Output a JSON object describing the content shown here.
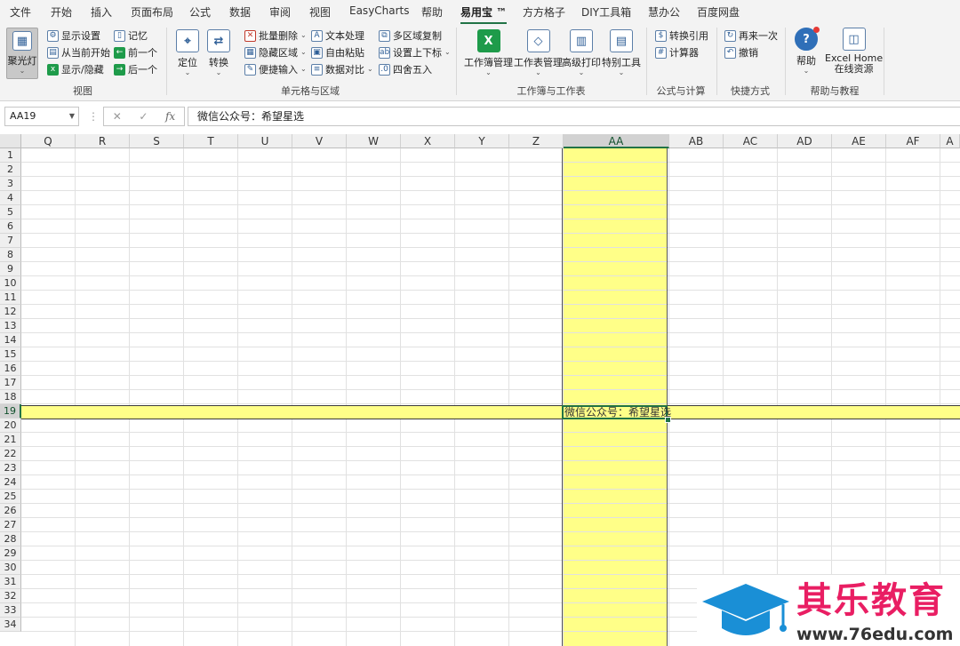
{
  "menu": {
    "tabs": [
      "文件",
      "开始",
      "插入",
      "页面布局",
      "公式",
      "数据",
      "审阅",
      "视图",
      "EasyCharts",
      "帮助",
      "易用宝 ™",
      "方方格子",
      "DIY工具箱",
      "慧办公",
      "百度网盘"
    ],
    "active_index": 10
  },
  "ribbon": {
    "view_group": {
      "label": "视图",
      "spotlight": "聚光灯",
      "show_settings": "显示设置",
      "start_from_current": "从当前开始",
      "show_hide": "显示/隐藏",
      "memory": "记忆",
      "previous": "前一个",
      "next": "后一个"
    },
    "cells_group": {
      "label": "单元格与区域",
      "locate": "定位",
      "convert": "转换",
      "batch_delete": "批量删除",
      "hide_region": "隐藏区域",
      "quick_input": "便捷输入",
      "text_process": "文本处理",
      "free_paste": "自由粘贴",
      "data_compare": "数据对比",
      "multi_copy": "多区域复制",
      "sup_sub": "设置上下标",
      "round": "四舍五入"
    },
    "workbook_group": {
      "label": "工作簿与工作表",
      "workbook_mgmt": "工作簿管理",
      "sheet_mgmt": "工作表管理",
      "adv_print": "高级打印",
      "special_tools": "特别工具"
    },
    "formula_group": {
      "label": "公式与计算",
      "convert_ref": "转换引用",
      "calculator": "计算器"
    },
    "shortcut_group": {
      "label": "快捷方式",
      "repeat": "再来一次",
      "undo": "撤销"
    },
    "help_group": {
      "label": "帮助与教程",
      "help": "帮助",
      "excel_home": "Excel Home",
      "online": "在线资源"
    }
  },
  "formula_bar": {
    "name_box": "AA19",
    "fx": "fx",
    "content": "微信公众号：希望星选"
  },
  "grid": {
    "columns": [
      "Q",
      "R",
      "S",
      "T",
      "U",
      "V",
      "W",
      "X",
      "Y",
      "Z",
      "AA",
      "AB",
      "AC",
      "AD",
      "AE",
      "AF",
      "A"
    ],
    "selected_column": "AA",
    "rows": [
      "1",
      "2",
      "3",
      "4",
      "5",
      "6",
      "7",
      "8",
      "9",
      "10",
      "11",
      "12",
      "13",
      "14",
      "15",
      "16",
      "17",
      "18",
      "19",
      "20",
      "21",
      "22",
      "23",
      "24",
      "25",
      "26",
      "27",
      "28",
      "29",
      "30",
      "31",
      "32",
      "33",
      "34"
    ],
    "selected_row": "19",
    "active_cell_text": "微信公众号：希望星选"
  },
  "watermark": {
    "title": "其乐教育",
    "url": "www.76edu.com"
  },
  "colors": {
    "highlight": "#ffff88",
    "excel_green": "#217346",
    "watermark_pink": "#e91e63",
    "watermark_blue": "#1a8fd6"
  }
}
